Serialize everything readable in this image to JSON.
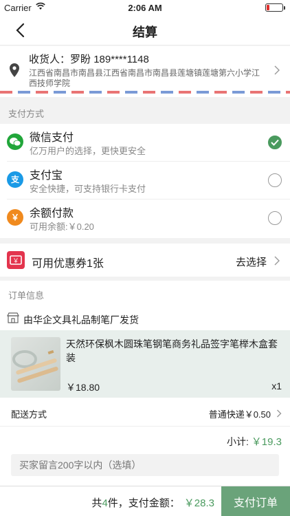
{
  "status_bar": {
    "carrier": "Carrier",
    "time": "2:06 AM"
  },
  "nav": {
    "title": "结算"
  },
  "address": {
    "receiver_label": "收货人：",
    "receiver_name": "罗盼",
    "phone": "189****1148",
    "detail": "江西省南昌市南昌县江西省南昌市南昌县莲塘镇莲塘第六小学江西技师学院"
  },
  "payment": {
    "section_label": "支付方式",
    "options": [
      {
        "name": "微信支付",
        "desc": "亿万用户的选择，更快更安全",
        "icon": "wechat-pay-icon",
        "color": "#21a63a",
        "selected": true
      },
      {
        "name": "支付宝",
        "desc": "安全快捷，可支持银行卡支付",
        "icon": "alipay-icon",
        "color": "#1a9ae6",
        "selected": false
      },
      {
        "name": "余额付款",
        "desc": "可用余额:￥0.20",
        "icon": "balance-icon",
        "color": "#f08a1e",
        "selected": false
      }
    ]
  },
  "coupon": {
    "label": "可用优惠券1张",
    "action": "去选择"
  },
  "order": {
    "section_label": "订单信息",
    "store": "由华企文具礼品制笔厂发货",
    "product": {
      "name": "天然环保枫木圆珠笔钢笔商务礼品签字笔榉木盒套装",
      "price": "￥18.80",
      "qty": "x1"
    },
    "shipping_label": "配送方式",
    "shipping_value": "普通快递￥0.50",
    "subtotal_label": "小计:",
    "subtotal_value": "￥19.3",
    "remark_placeholder": "买家留言200字以内（选填）"
  },
  "footer": {
    "count_prefix": "共",
    "count": "4",
    "count_suffix": "件，支付金额：",
    "amount": "￥28.3",
    "submit_label": "支付订单"
  },
  "colors": {
    "accent": "#4a9a5e",
    "submit_bg": "#6aa37a",
    "coupon_red": "#e3344d"
  }
}
